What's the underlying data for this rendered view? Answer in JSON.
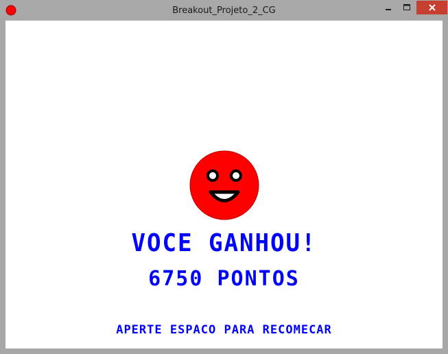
{
  "window": {
    "title": "Breakout_Projeto_2_CG"
  },
  "game": {
    "headline": "VOCE GANHOU!",
    "score": "6750 PONTOS",
    "hint": "APERTE ESPACO PARA RECOMECAR"
  },
  "colors": {
    "text": "#0000ff",
    "smiley": "#ff0000",
    "close_button": "#c7402f"
  },
  "icons": [
    "app-icon",
    "minimize-icon",
    "maximize-icon",
    "close-icon",
    "smiley-face-icon"
  ]
}
